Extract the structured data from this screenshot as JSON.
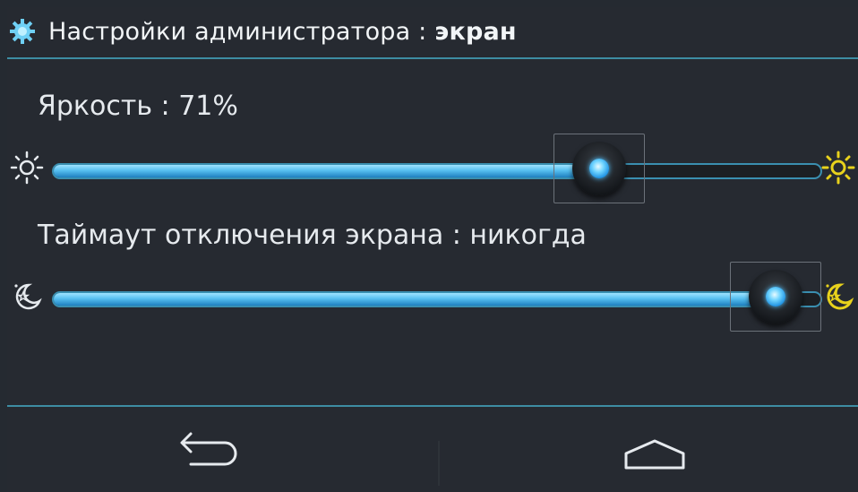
{
  "header": {
    "title_prefix": "Настройки администратора : ",
    "title_section": "экран",
    "icon": "gear-icon"
  },
  "brightness": {
    "label": "Яркость : 71%",
    "value_percent": 71,
    "icon_low": "sun-dim-icon",
    "icon_high": "sun-bright-icon"
  },
  "timeout": {
    "label": "Таймаут отключения экрана : никогда",
    "value_fraction": 0.94,
    "icon_low": "moon-stars-dim-icon",
    "icon_high": "moon-stars-bright-icon"
  },
  "nav": {
    "back": "back-arrow-icon",
    "home": "home-icon"
  },
  "colors": {
    "accent": "#3d8da3",
    "fill": "#56bff0",
    "icon_high": "#e8d21c"
  }
}
